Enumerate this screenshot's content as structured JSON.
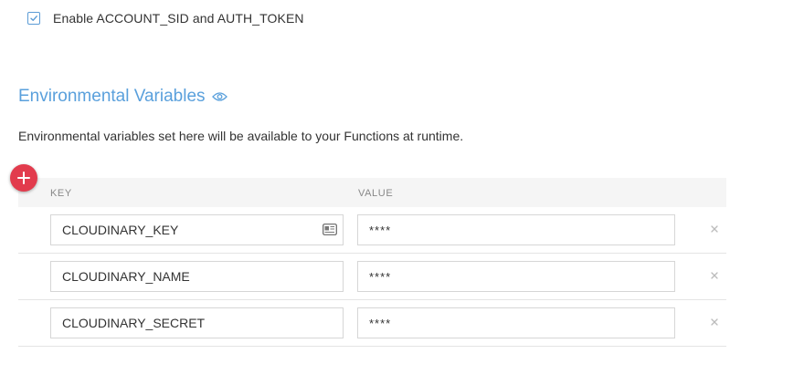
{
  "checkbox": {
    "label": "Enable ACCOUNT_SID and AUTH_TOKEN",
    "checked": true
  },
  "section": {
    "title": "Environmental Variables",
    "description": "Environmental variables set here will be available to your Functions at runtime."
  },
  "table": {
    "headers": {
      "key": "KEY",
      "value": "VALUE"
    },
    "rows": [
      {
        "key": "CLOUDINARY_KEY",
        "value": "****"
      },
      {
        "key": "CLOUDINARY_NAME",
        "value": "****"
      },
      {
        "key": "CLOUDINARY_SECRET",
        "value": "****"
      }
    ]
  },
  "icons": {
    "checkbox": "check-icon",
    "title": "eye-icon",
    "add": "plus-icon",
    "autofill": "contact-card-icon",
    "remove": "close-icon"
  },
  "colors": {
    "accent": "#5aa0dc",
    "add_button": "#e23b4d",
    "header_bg": "#f5f5f5"
  }
}
